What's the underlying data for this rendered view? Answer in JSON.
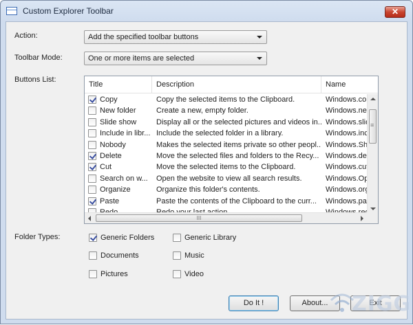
{
  "window": {
    "title": "Custom Explorer Toolbar",
    "close_glyph": "✕"
  },
  "form": {
    "action_label": "Action:",
    "action_value": "Add the specified toolbar buttons",
    "mode_label": "Toolbar Mode:",
    "mode_value": "One or more items are selected",
    "buttons_list_label": "Buttons List:",
    "folder_types_label": "Folder Types:"
  },
  "list": {
    "columns": [
      "Title",
      "Description",
      "Name"
    ],
    "rows": [
      {
        "checked": true,
        "title": "Copy",
        "description": "Copy the selected items to the Clipboard.",
        "name": "Windows.copy"
      },
      {
        "checked": false,
        "title": "New folder",
        "description": "Create a new, empty folder.",
        "name": "Windows.newfol"
      },
      {
        "checked": false,
        "title": "Slide show",
        "description": "Display all or the selected pictures and videos in...",
        "name": "Windows.slidesh"
      },
      {
        "checked": false,
        "title": "Include in libr...",
        "description": "Include the selected folder in a library.",
        "name": "Windows.include"
      },
      {
        "checked": false,
        "title": "Nobody",
        "description": "Makes the selected items private so other peopl...",
        "name": "Windows.ShareP"
      },
      {
        "checked": true,
        "title": "Delete",
        "description": "Move the selected files and folders to the Recy...",
        "name": "Windows.delete"
      },
      {
        "checked": true,
        "title": "Cut",
        "description": "Move the selected items to the Clipboard.",
        "name": "Windows.cut"
      },
      {
        "checked": false,
        "title": "Search on w...",
        "description": "Open the website to view all search results.",
        "name": "Windows.OpenS"
      },
      {
        "checked": false,
        "title": "Organize",
        "description": "Organize this folder's contents.",
        "name": "Windows.organi"
      },
      {
        "checked": true,
        "title": "Paste",
        "description": "Paste the contents of the Clipboard to the curr...",
        "name": "Windows.paste"
      },
      {
        "checked": false,
        "title": "Redo",
        "description": "Redo your last action.",
        "name": "Windows.redo"
      }
    ],
    "hscroll_grip": "III",
    "vscroll_grip": "≡"
  },
  "folder_types": [
    {
      "label": "Generic Folders",
      "checked": true
    },
    {
      "label": "Generic Library",
      "checked": false
    },
    {
      "label": "Documents",
      "checked": false
    },
    {
      "label": "Music",
      "checked": false
    },
    {
      "label": "Pictures",
      "checked": false
    },
    {
      "label": "Video",
      "checked": false
    }
  ],
  "buttons": {
    "doit_label": "Do It !",
    "about_label": "About...",
    "exit_label": "Exit"
  },
  "watermark": {
    "text": "ZIGG"
  },
  "colors": {
    "title_gradient_top": "#dbe6f4",
    "client_bg": "#f0f0f0",
    "close_red": "#c9452f",
    "check_color": "#3a4fa0"
  }
}
